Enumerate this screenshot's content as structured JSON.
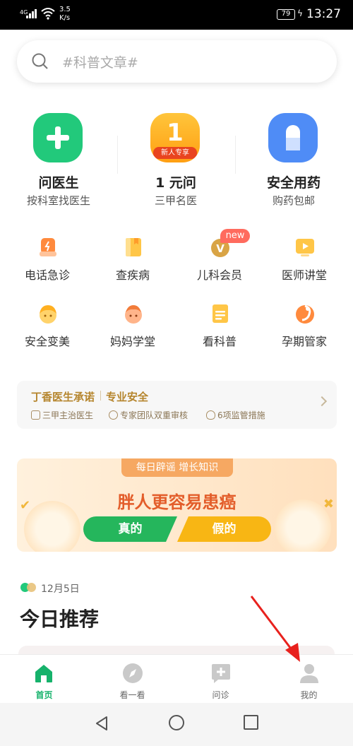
{
  "status_bar": {
    "network": "4G",
    "speed": "3.5\nK/s",
    "battery": "79",
    "time": "13:27"
  },
  "search": {
    "placeholder": "#科普文章#"
  },
  "features": [
    {
      "title": "问医生",
      "subtitle": "按科室找医生",
      "icon": "plus-icon",
      "color": "#1fcc7d"
    },
    {
      "title": "1 元问",
      "subtitle": "三甲名医",
      "icon": "one-yuan-icon",
      "badge": "新人专享",
      "badge_digit": "1",
      "color": "#ffab1a"
    },
    {
      "title": "安全用药",
      "subtitle": "购药包邮",
      "icon": "pill-icon",
      "color": "#4d8bf5"
    }
  ],
  "grid": [
    {
      "label": "电话急诊",
      "icon": "phone-emergency-icon"
    },
    {
      "label": "查疾病",
      "icon": "book-icon"
    },
    {
      "label": "儿科会员",
      "icon": "vip-icon",
      "badge": "new"
    },
    {
      "label": "医师讲堂",
      "icon": "video-play-icon"
    },
    {
      "label": "安全变美",
      "icon": "beauty-face-icon"
    },
    {
      "label": "妈妈学堂",
      "icon": "baby-face-icon"
    },
    {
      "label": "看科普",
      "icon": "document-icon"
    },
    {
      "label": "孕期管家",
      "icon": "pregnancy-icon"
    }
  ],
  "promise": {
    "title": "丁香医生承诺",
    "subtitle": "专业安全",
    "items": [
      "三甲主治医生",
      "专家团队双重审核",
      "6项监管措施"
    ]
  },
  "quiz": {
    "tag": "每日辟谣 增长知识",
    "question": "胖人更容易患癌",
    "true_label": "真的",
    "false_label": "假的"
  },
  "date": "12月5日",
  "section_title": "今日推荐",
  "tabs": [
    {
      "label": "首页",
      "icon": "home-icon",
      "active": true
    },
    {
      "label": "看一看",
      "icon": "compass-icon",
      "active": false
    },
    {
      "label": "问诊",
      "icon": "consult-icon",
      "active": false
    },
    {
      "label": "我的",
      "icon": "profile-icon",
      "active": false
    }
  ],
  "colors": {
    "brand_green": "#16b26b",
    "annotation_arrow": "#e8211d"
  }
}
